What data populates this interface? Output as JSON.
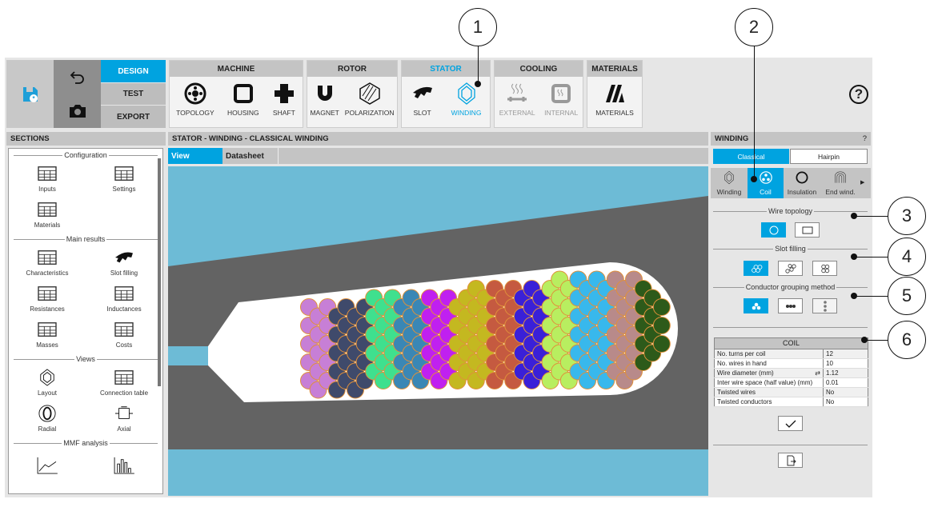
{
  "colors": {
    "accent": "#00a3e0",
    "panel": "#c4c4c4",
    "stator_bg": "#6dbbd6",
    "iron": "#636363",
    "wire_stroke": "#e0903a"
  },
  "toolbar": {
    "design": "DESIGN",
    "test": "TEST",
    "export": "EXPORT",
    "groups": [
      {
        "title": "MACHINE",
        "items": [
          "TOPOLOGY",
          "HOUSING",
          "SHAFT"
        ]
      },
      {
        "title": "ROTOR",
        "items": [
          "MAGNET",
          "POLARIZATION"
        ]
      },
      {
        "title": "STATOR",
        "items": [
          "SLOT",
          "WINDING"
        ]
      },
      {
        "title": "COOLING",
        "items": [
          "EXTERNAL",
          "INTERNAL"
        ]
      },
      {
        "title": "MATERIALS",
        "items": [
          "MATERIALS"
        ]
      }
    ],
    "help": "?"
  },
  "sections": {
    "title": "SECTIONS",
    "configuration": "Configuration",
    "inputs": "Inputs",
    "settings": "Settings",
    "materials": "Materials",
    "main_results": "Main results",
    "characteristics": "Characteristics",
    "slot_filling": "Slot filling",
    "resistances": "Resistances",
    "inductances": "Inductances",
    "masses": "Masses",
    "costs": "Costs",
    "views": "Views",
    "layout": "Layout",
    "connection_table": "Connection table",
    "radial": "Radial",
    "axial": "Axial",
    "mmf": "MMF analysis"
  },
  "main": {
    "title": "STATOR - WINDING - CLASSICAL WINDING",
    "tab_view": "View",
    "tab_datasheet": "Datasheet"
  },
  "winding": {
    "title": "WINDING",
    "help": "?",
    "classical": "Classical",
    "hairpin": "Hairpin",
    "tabs": [
      "Winding",
      "Coil",
      "Insulation",
      "End wind."
    ],
    "wire_topology": "Wire topology",
    "slot_filling": "Slot filling",
    "grouping": "Conductor grouping method",
    "coil": {
      "title": "COIL",
      "rows": [
        {
          "label": "No. turns per coil",
          "value": "12"
        },
        {
          "label": "No. wires in hand",
          "value": "10"
        },
        {
          "label": "Wire diameter (mm)",
          "value": "1.12"
        },
        {
          "label": "Inter wire space (half value) (mm)",
          "value": "0.01"
        },
        {
          "label": "Twisted wires",
          "value": "No"
        },
        {
          "label": "Twisted conductors",
          "value": "No"
        }
      ]
    }
  },
  "callouts": [
    "1",
    "2",
    "3",
    "4",
    "5",
    "6"
  ],
  "wire_colors": [
    "#c77fd6",
    "#3f4a6b",
    "#3fe08e",
    "#3a87b5",
    "#c020f0",
    "#c4b820",
    "#c55a40",
    "#3a20d8",
    "#b8ee60",
    "#38b8ec",
    "#b88a8a",
    "#2d5a1a"
  ]
}
